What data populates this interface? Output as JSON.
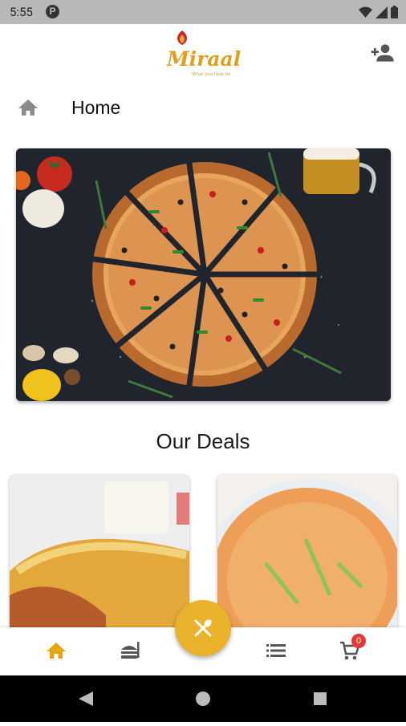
{
  "status_bar": {
    "time": "5:55",
    "notification_icon": "p-icon"
  },
  "app_bar": {
    "logo_text": "Miraal",
    "logo_tagline": "What you love for",
    "add_user_icon": "person-add-icon"
  },
  "breadcrumb": {
    "title": "Home",
    "icon": "home-icon"
  },
  "banner": {
    "subject": "pizza"
  },
  "deals": {
    "title": "Our Deals"
  },
  "bottom_nav": {
    "items": [
      {
        "name": "home",
        "icon": "home-icon",
        "active": true
      },
      {
        "name": "menu",
        "icon": "burger-icon",
        "active": false
      },
      {
        "name": "orders",
        "icon": "list-icon",
        "active": false
      },
      {
        "name": "cart",
        "icon": "cart-icon",
        "active": false
      }
    ],
    "cart_count": "0",
    "fab_icon": "utensils-icon"
  },
  "colors": {
    "accent": "#e9b22a",
    "active_nav": "#e9a50f",
    "badge": "#e53935"
  }
}
